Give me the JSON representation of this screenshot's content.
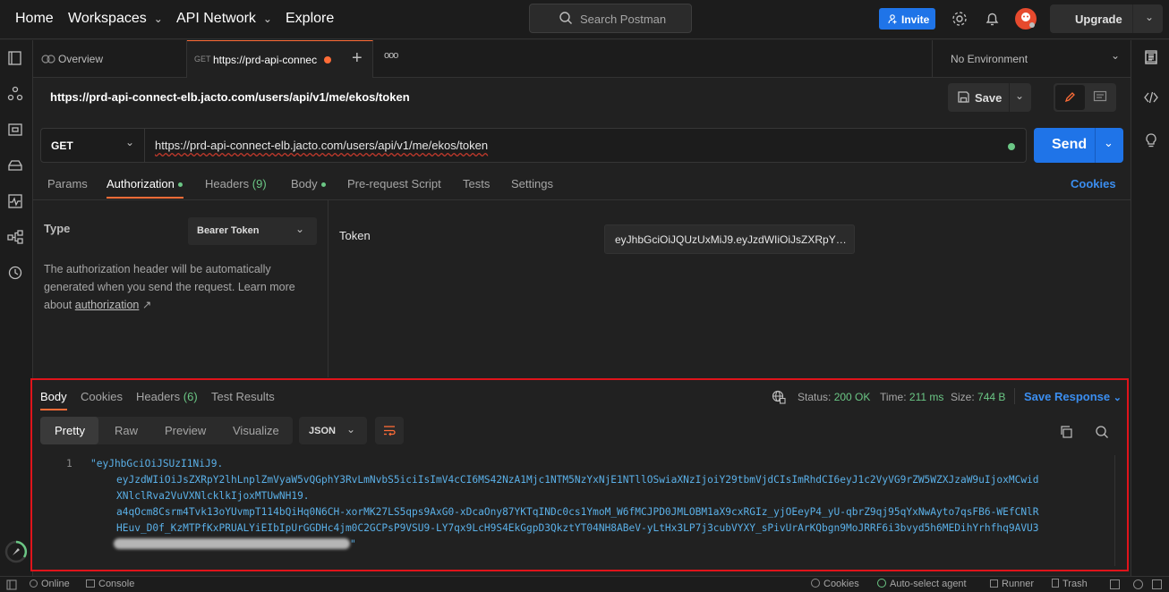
{
  "topbar": {
    "home": "Home",
    "workspaces": "Workspaces",
    "api_network": "API Network",
    "explore": "Explore",
    "search_placeholder": "Search Postman",
    "invite": "Invite",
    "upgrade": "Upgrade"
  },
  "tabs": {
    "overview": "Overview",
    "active_method": "GET",
    "active_title": "https://prd-api-connec",
    "more": "ooo",
    "environment": "No Environment"
  },
  "request": {
    "title": "https://prd-api-connect-elb.jacto.com/users/api/v1/me/ekos/token",
    "save": "Save",
    "method": "GET",
    "url": "https://prd-api-connect-elb.jacto.com/users/api/v1/me/ekos/token",
    "send": "Send"
  },
  "request_tabs": {
    "params": "Params",
    "authorization": "Authorization",
    "headers": "Headers",
    "headers_count": "(9)",
    "body": "Body",
    "prerequest": "Pre-request Script",
    "tests": "Tests",
    "settings": "Settings",
    "cookies": "Cookies"
  },
  "auth": {
    "type_label": "Type",
    "type_value": "Bearer Token",
    "desc_prefix": "The authorization header will be automatically generated when you send the request. Learn more about ",
    "desc_link": "authorization",
    "desc_arrow": "↗",
    "token_label": "Token",
    "token_value": "eyJhbGciOiJQUzUxMiJ9.eyJzdWIiOiJsZXRpY2lhLnplZmVyaW5v"
  },
  "response": {
    "tabs": {
      "body": "Body",
      "cookies": "Cookies",
      "headers": "Headers",
      "headers_count": "(6)",
      "test_results": "Test Results"
    },
    "status_label": "Status:",
    "status_value": "200 OK",
    "time_label": "Time:",
    "time_value": "211 ms",
    "size_label": "Size:",
    "size_value": "744 B",
    "save_response": "Save Response",
    "formats": {
      "pretty": "Pretty",
      "raw": "Raw",
      "preview": "Preview",
      "visualize": "Visualize"
    },
    "language": "JSON",
    "line_number": "1",
    "code_lines": [
      "\"eyJhbGciOiJSUzI1NiJ9.",
      "eyJzdWIiOiJsZXRpY2lhLnplZmVyaW5vQGphY3RvLmNvbS5iciIsImV4cCI6MS42NzA1Mjc1NTM5NzYxNjE1NTllOSwiaXNzIjoiY29tbmVjdCIsImRhdCI6eyJ1c2VyVG9rZW5WZXJzaW9uIjoxMCwid",
      "XNlclRva2VuVXNlcklkIjoxMTUwNH19.",
      "a4qOcm8Csrm4Tvk13oYUvmpT114bQiHq0N6CH-xorMK27LS5qps9AxG0-xDcaOny87YKTqINDc0cs1YmoM_W6fMCJPD0JMLOBM1aX9cxRGIz_yjOEeyP4_yU-qbrZ9qj95qYxNwAyto7qsFB6-WEfCNlR",
      "HEuv_D0f_KzMTPfKxPRUALYiEIbIpUrGGDHc4jm0C2GCPsP9VSU9-LY7qx9LcH9S4EkGgpD3QkztYT04NH8ABeV-yLtHx3LP7j3cubVYXY_sPivUrArKQbgn9MoJRRF6i3bvyd5h6MEDihYrhfhq9AVU3",
      "\""
    ]
  },
  "statusbar": {
    "online": "Online",
    "console": "Console",
    "cookies": "Cookies",
    "auto_select_agent": "Auto-select agent",
    "runner": "Runner",
    "trash": "Trash"
  },
  "colors": {
    "accent_orange": "#ff6c37",
    "brand_blue": "#1f74e8",
    "success_green": "#6bc785",
    "highlight_red": "#e0141b"
  }
}
